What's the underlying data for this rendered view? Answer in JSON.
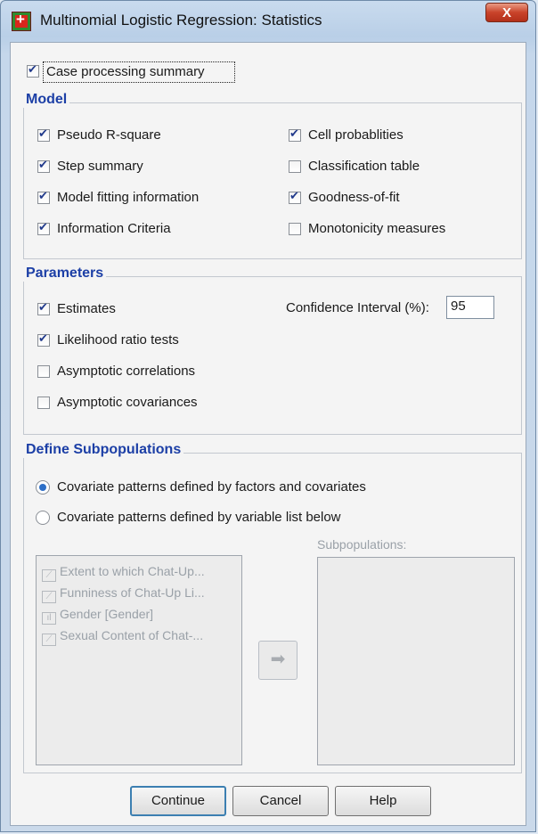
{
  "window": {
    "title": "Multinomial Logistic Regression: Statistics",
    "close_label": "X"
  },
  "case_processing": {
    "label": "Case processing summary",
    "checked": true
  },
  "model": {
    "title": "Model",
    "items": [
      {
        "label": "Pseudo R-square",
        "checked": true
      },
      {
        "label": "Step summary",
        "checked": true
      },
      {
        "label": "Model fitting information",
        "checked": true
      },
      {
        "label": "Information Criteria",
        "checked": true
      },
      {
        "label": "Cell probablities",
        "checked": true
      },
      {
        "label": "Classification table",
        "checked": false
      },
      {
        "label": "Goodness-of-fit",
        "checked": true
      },
      {
        "label": "Monotonicity measures",
        "checked": false
      }
    ]
  },
  "parameters": {
    "title": "Parameters",
    "items": [
      {
        "label": "Estimates",
        "checked": true
      },
      {
        "label": "Likelihood ratio tests",
        "checked": true
      },
      {
        "label": "Asymptotic correlations",
        "checked": false
      },
      {
        "label": "Asymptotic covariances",
        "checked": false
      }
    ],
    "ci_label": "Confidence Interval (%):",
    "ci_value": "95"
  },
  "subpopulations": {
    "title": "Define Subpopulations",
    "options": [
      {
        "label": "Covariate patterns defined by factors and covariates",
        "selected": true
      },
      {
        "label": "Covariate patterns defined by variable list below",
        "selected": false
      }
    ],
    "variables": [
      {
        "label": "Extent to which Chat-Up...",
        "icon": "scale-icon"
      },
      {
        "label": "Funniness of Chat-Up Li...",
        "icon": "scale-icon"
      },
      {
        "label": "Gender [Gender]",
        "icon": "nominal-icon"
      },
      {
        "label": "Sexual Content of Chat-...",
        "icon": "scale-icon"
      }
    ],
    "subpop_label": "Subpopulations:"
  },
  "buttons": {
    "continue": "Continue",
    "cancel": "Cancel",
    "help": "Help"
  }
}
